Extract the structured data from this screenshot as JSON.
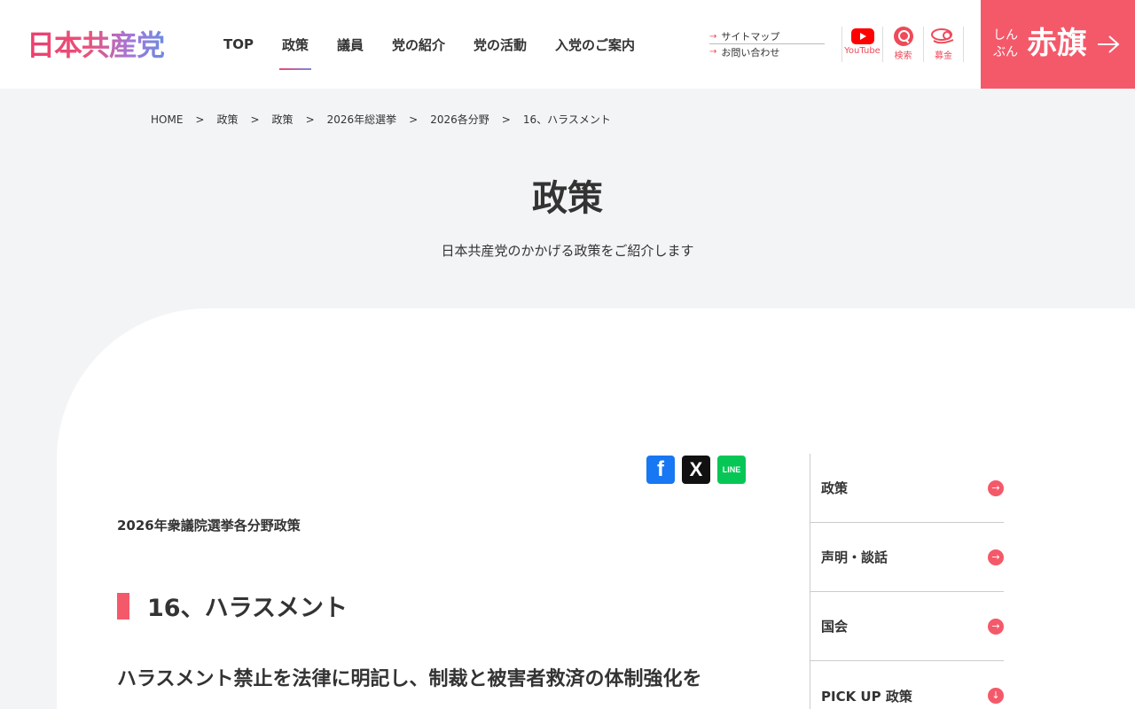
{
  "header": {
    "logo_text": "日本共産党",
    "nav": [
      {
        "label": "TOP",
        "active": false
      },
      {
        "label": "政策",
        "active": true
      },
      {
        "label": "議員",
        "active": false
      },
      {
        "label": "党の紹介",
        "active": false
      },
      {
        "label": "党の活動",
        "active": false
      },
      {
        "label": "入党のご案内",
        "active": false
      }
    ],
    "sub_links": [
      {
        "label": "サイトマップ"
      },
      {
        "label": "お問い合わせ"
      }
    ],
    "icons": [
      {
        "label": "YouTube",
        "icon": "youtube-icon"
      },
      {
        "label": "検索",
        "icon": "search-icon"
      },
      {
        "label": "募金",
        "icon": "donation-icon"
      }
    ],
    "akahata": {
      "small_line1": "しん",
      "small_line2": "ぶん",
      "big": "赤旗"
    }
  },
  "breadcrumb": [
    {
      "label": "HOME"
    },
    {
      "label": "政策"
    },
    {
      "label": "政策"
    },
    {
      "label": "2026年総選挙"
    },
    {
      "label": "2026各分野"
    },
    {
      "label": "16、ハラスメント"
    }
  ],
  "page": {
    "title": "政策",
    "subtitle": "日本共産党のかかげる政策をご紹介します"
  },
  "share": [
    {
      "label": "f",
      "icon": "facebook-icon"
    },
    {
      "label": "X",
      "icon": "x-icon"
    },
    {
      "label": "LINE",
      "icon": "line-icon"
    }
  ],
  "article": {
    "lead": "2026年衆議院選挙各分野政策",
    "section_title": "16、ハラスメント",
    "headline": "ハラスメント禁止を法律に明記し、制裁と被害者救済の体制強化を"
  },
  "side_menu": [
    {
      "label": "政策",
      "arrow": "→"
    },
    {
      "label": "声明・談話",
      "arrow": "→"
    },
    {
      "label": "国会",
      "arrow": "→"
    },
    {
      "label": "PICK UP 政策",
      "arrow": "↓"
    }
  ],
  "colors": {
    "accent": "#f4596a",
    "background": "#f3f4f6",
    "youtube": "#ff0000",
    "facebook": "#1877f2",
    "line": "#06c755"
  }
}
